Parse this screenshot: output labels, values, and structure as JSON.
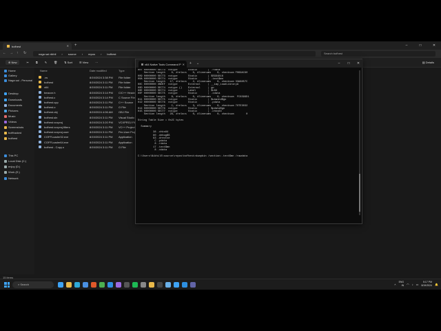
{
  "explorer": {
    "tab_title": "bofhest",
    "path": [
      "naga sai nikhil",
      "source",
      "repos",
      "bofhest"
    ],
    "search_placeholder": "Search bofhest",
    "new_label": "New",
    "sort_label": "Sort",
    "view_label": "View",
    "details_label": "Details",
    "columns": [
      "Name",
      "Date modified",
      "Type",
      "Size"
    ],
    "sidebar": [
      {
        "label": "Home",
        "color": "#3c8ddb"
      },
      {
        "label": "Gallery",
        "color": "#3c8ddb"
      },
      {
        "label": "Naga sai - Personal",
        "color": "#3c8ddb"
      },
      {
        "label": "Desktop",
        "color": "#3ea3f5"
      },
      {
        "label": "Downloads",
        "color": "#3ea3f5"
      },
      {
        "label": "Documents",
        "color": "#8fb3e0"
      },
      {
        "label": "Pictures",
        "color": "#4aa5e8"
      },
      {
        "label": "Music",
        "color": "#e06a6a"
      },
      {
        "label": "Videos",
        "color": "#9a6ae0"
      },
      {
        "label": "Screenshots",
        "color": "#e8b84a"
      },
      {
        "label": "bofHacked",
        "color": "#e8b84a"
      },
      {
        "label": "bofhest",
        "color": "#e8b84a"
      },
      {
        "label": "This PC",
        "color": "#3c8ddb"
      },
      {
        "label": "Local Disk (C:)",
        "color": "#9aa"
      },
      {
        "label": "enjoy (D:)",
        "color": "#9aa"
      },
      {
        "label": "Work (E:)",
        "color": "#9aa"
      },
      {
        "label": "Network",
        "color": "#3c8ddb"
      }
    ],
    "files": [
      {
        "name": ".vs",
        "date": "8/19/2024 3:38 PM",
        "type": "File folder",
        "size": "",
        "folder": true
      },
      {
        "name": "bofhest",
        "date": "8/19/2024 3:11 PM",
        "type": "File folder",
        "size": "",
        "folder": true
      },
      {
        "name": "x64",
        "date": "8/19/2024 3:11 PM",
        "type": "File folder",
        "size": "",
        "folder": true
      },
      {
        "name": "beacon.h",
        "date": "8/19/2024 3:14 PM",
        "type": "C/C++ Header",
        "size": "17 KB",
        "folder": false
      },
      {
        "name": "bofhest.c",
        "date": "8/19/2024 3:14 PM",
        "type": "C Source File",
        "size": "",
        "folder": false
      },
      {
        "name": "bofhest.cpp",
        "date": "8/19/2024 3:11 PM",
        "type": "C++ Source",
        "size": "",
        "folder": false
      },
      {
        "name": "bofhest.o",
        "date": "8/19/2024 3:11 PM",
        "type": "O File",
        "size": "",
        "folder": false
      },
      {
        "name": "bofhest.obj",
        "date": "8/19/2024 4:06 AM",
        "type": "OBJ File",
        "size": "",
        "folder": false
      },
      {
        "name": "bofhest.sln",
        "date": "8/19/2024 3:11 PM",
        "type": "Visual Studio Sol",
        "size": "",
        "folder": false
      },
      {
        "name": "bofhest.vcxproj",
        "date": "8/19/2024 3:20 PM",
        "type": "VCXPROJ File",
        "size": "",
        "folder": false
      },
      {
        "name": "bofhest.vcxproj.filters",
        "date": "8/19/2024 3:11 PM",
        "type": "VC++ Project Filt",
        "size": "",
        "folder": false
      },
      {
        "name": "bofhest.vcxproj.user",
        "date": "8/19/2024 3:11 PM",
        "type": "Per-User Project",
        "size": "",
        "folder": false
      },
      {
        "name": "COFFLoader32.exe",
        "date": "8/19/2024 3:11 PM",
        "type": "Application",
        "size": "",
        "folder": false
      },
      {
        "name": "COFFLoader64.exe",
        "date": "8/19/2024 3:11 PM",
        "type": "Application",
        "size": "",
        "folder": false
      },
      {
        "name": "bofhest - Copy.o",
        "date": "8/19/2024 3:11 PM",
        "type": "O File",
        "size": "",
        "folder": false
      }
    ],
    "status": "15 items"
  },
  "terminal": {
    "tab_title": "x64 Native Tools Command P",
    "lines": [
      "007 00000000 SECT3  notype       Static       | .rdata",
      "    Section length    0, #relocs    0, #linenums    0, checksum F069AC90",
      "009 00000000 SECT3  notype       Static       | $SG94816",
      "00A 00000000 SECT4  notype       Static       | .text$mn",
      "    Section length   17, #relocs    2, #linenums    0, checksum 33A8857C",
      "00C 00000000 UNDEF  notype       External     | __imp_LoadLibraryA",
      "00D 00000000 SECT4  notype ()    External     | go",
      "00E 00000000 SECT4  notype       Label        | $LN3",
      "00F 00000000 SECT5  notype       Static       | .xdata",
      "    Section length    8, #relocs    0, #linenums    0, checksum  FC8399D1",
      "011 00000000 SECT5  notype       Static       | $unwind$go",
      "012 00000000 SECT6  notype       Static       | .pdata",
      "    Section length    C, #relocs    3, #linenums    0, checksum 7OTE3032",
      "014 00000000 SECT6  notype       Static       | $pdata$go",
      "015 00000000 SECT7  notype       Static       | .chks64",
      "    Section length   28, #relocs    0, #linenums    0, checksum        0",
      "",
      "String Table Size = 0x2C bytes",
      "",
      "  Summary",
      "",
      "          38 .chks64",
      "          80 .debug$S",
      "          93 .drectve",
      "           C .pdata",
      "           8 .rdata",
      "          17 .text$mn",
      "           8 .xdata",
      "",
      "C:\\Users\\NikhilS\\source\\repos\\bofhest>dumpbin /section:.text$mn /rawdata"
    ]
  },
  "taskbar": {
    "search_placeholder": "Search",
    "lang": "ENG",
    "lang_sub": "IN",
    "time": "5:17 PM",
    "date": "8/19/2024",
    "pinned": [
      {
        "name": "widgets",
        "color": "#3ea3f5"
      },
      {
        "name": "explorer",
        "color": "#e8b84a"
      },
      {
        "name": "edge",
        "color": "#2ea9d8"
      },
      {
        "name": "store",
        "color": "#4a90e2"
      },
      {
        "name": "brave",
        "color": "#e0592a"
      },
      {
        "name": "chrome",
        "color": "#4caf50"
      },
      {
        "name": "vscode",
        "color": "#2d8fe0"
      },
      {
        "name": "vs",
        "color": "#9a6ae0"
      },
      {
        "name": "terminal",
        "color": "#555"
      },
      {
        "name": "spotify",
        "color": "#1db954"
      },
      {
        "name": "settings",
        "color": "#888"
      },
      {
        "name": "paint",
        "color": "#e8b84a"
      },
      {
        "name": "cmd",
        "color": "#444"
      },
      {
        "name": "notepad",
        "color": "#6ab0e8"
      },
      {
        "name": "photos",
        "color": "#3ea3f5"
      },
      {
        "name": "mail",
        "color": "#2d8fe0"
      },
      {
        "name": "teams",
        "color": "#6264a7"
      }
    ]
  }
}
